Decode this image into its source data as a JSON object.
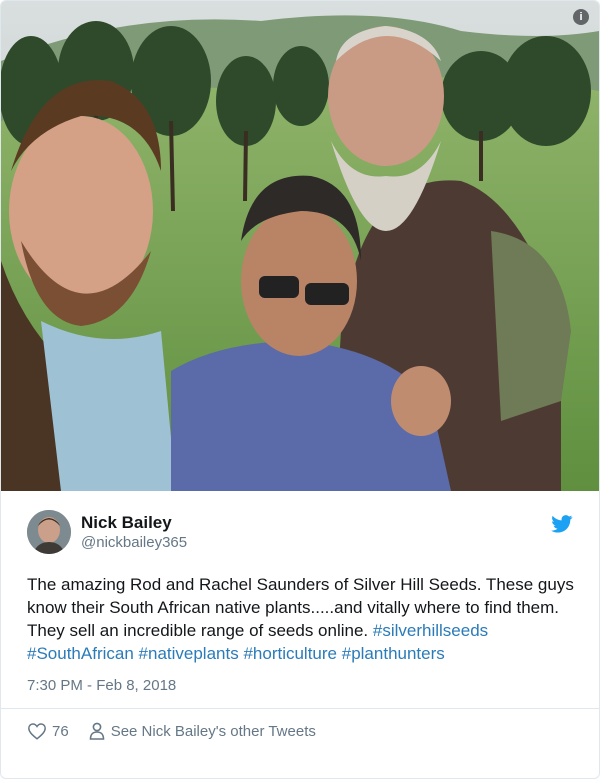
{
  "colors": {
    "link": "#2b7bb9",
    "text": "#14171a",
    "muted": "#657786",
    "twitter_blue": "#1da1f2"
  },
  "photo": {
    "icon": "info-icon",
    "info_glyph": "i"
  },
  "tweet": {
    "display_name": "Nick Bailey",
    "handle": "@nickbailey365",
    "text_plain": "The amazing Rod and Rachel Saunders of Silver Hill Seeds. These guys know their South African native plants.....and vitally where to find them. They sell an incredible  range of seeds online.",
    "hashtags": [
      "#silverhillseeds",
      "#SouthAfrican",
      "#nativeplants",
      "#horticulture",
      "#planthunters"
    ],
    "timestamp": "7:30 PM - Feb 8, 2018",
    "like_count": "76",
    "other_tweets_label": "See Nick Bailey's other Tweets",
    "brand_icon": "twitter-bird-icon"
  }
}
